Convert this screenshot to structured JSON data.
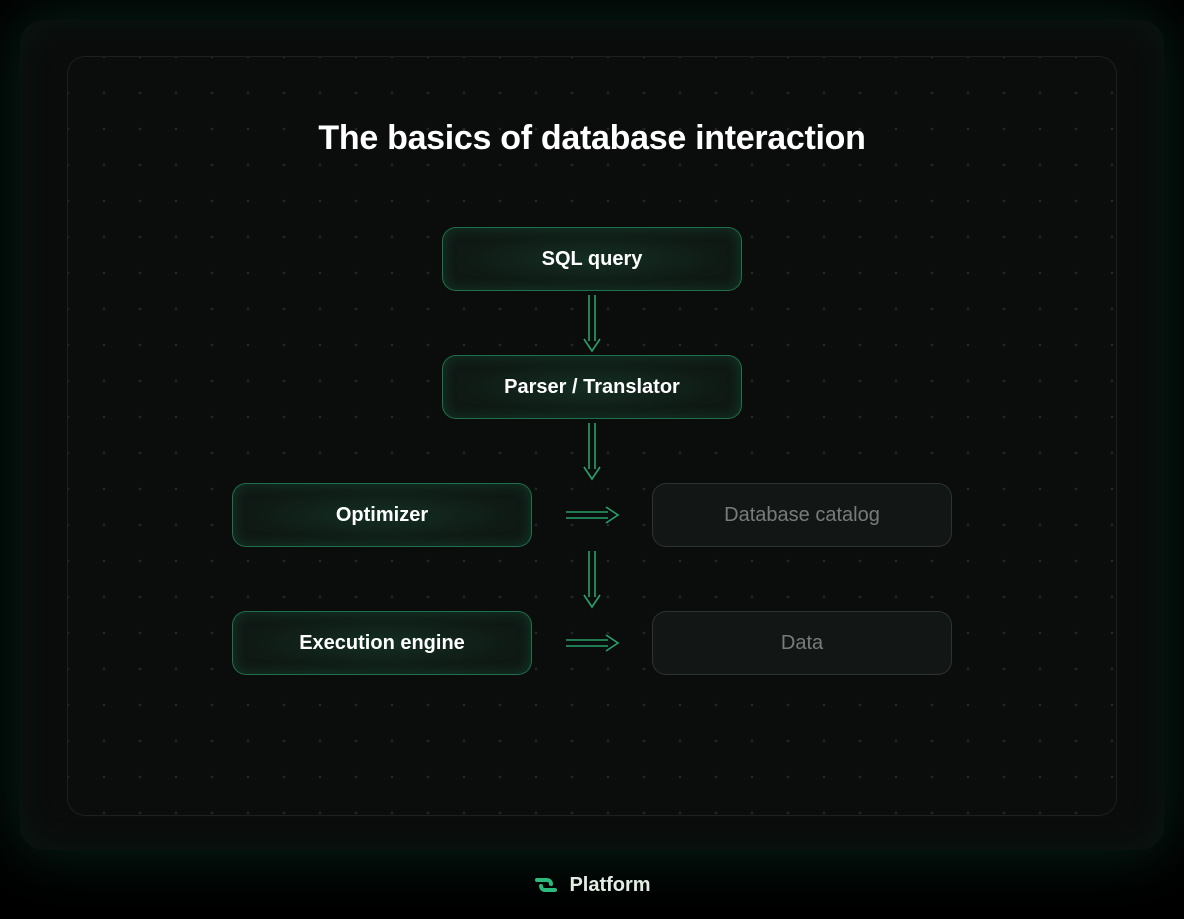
{
  "title": "The basics of database interaction",
  "nodes": {
    "sql_query": "SQL query",
    "parser_translator": "Parser / Translator",
    "optimizer": "Optimizer",
    "execution_engine": "Execution engine",
    "database_catalog": "Database catalog",
    "data": "Data"
  },
  "brand": {
    "name": "Platform"
  },
  "colors": {
    "accent": "#2eba7e",
    "background": "#0a0c0b"
  }
}
